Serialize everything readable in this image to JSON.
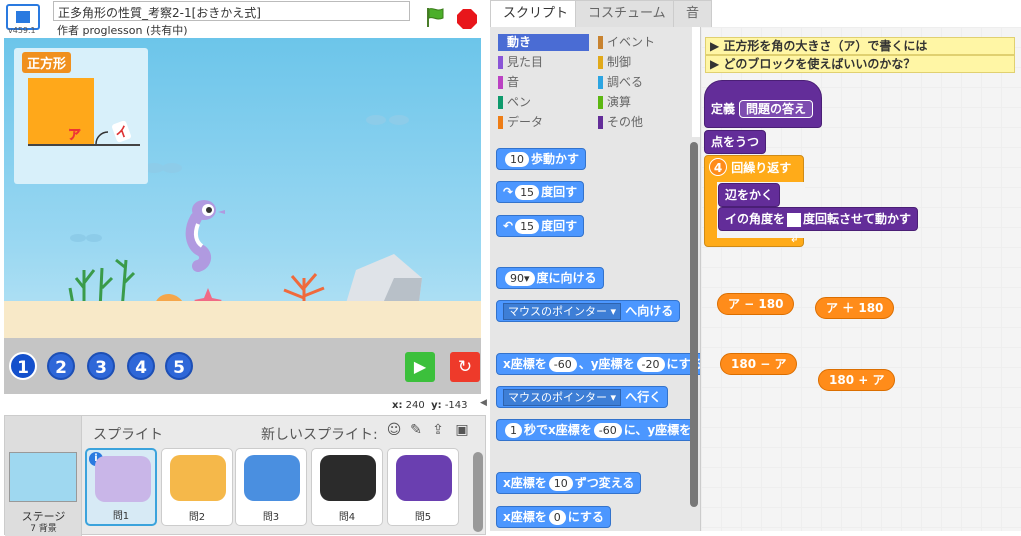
{
  "app": {
    "version": "v459.1",
    "project_title": "正多角形の性質_考察2-1[おきかえ式]",
    "author_line": "作者 proglesson (共有中)"
  },
  "stage": {
    "topic_label": "正方形",
    "angle_a": "ア",
    "angle_i": "イ",
    "number_buttons": [
      "1",
      "2",
      "3",
      "4",
      "5"
    ],
    "active_number": "1",
    "go_symbol": "▶",
    "reset_symbol": "↻",
    "coords": {
      "x_label": "x:",
      "x_value": "240",
      "y_label": "y:",
      "y_value": "-143"
    }
  },
  "sprites_panel": {
    "title": "スプライト",
    "new_sprite_label": "新しいスプライト:",
    "stage_label": "ステージ",
    "backdrop_count": "7 背景",
    "sprites": [
      {
        "name": "問1",
        "color": "#c9b6e8"
      },
      {
        "name": "問2",
        "color": "#f5b84a"
      },
      {
        "name": "問3",
        "color": "#4a8fe0"
      },
      {
        "name": "問4",
        "color": "#2b2b2b"
      },
      {
        "name": "問5",
        "color": "#6a3fb0"
      }
    ],
    "info_symbol": "i"
  },
  "tabs": [
    "スクリプト",
    "コスチューム",
    "音"
  ],
  "categories": [
    {
      "label": "動き",
      "color": "#4a6cd4",
      "active": true
    },
    {
      "label": "イベント",
      "color": "#c88330"
    },
    {
      "label": "見た目",
      "color": "#8a55d7"
    },
    {
      "label": "制御",
      "color": "#e1a91a"
    },
    {
      "label": "音",
      "color": "#bb42c3"
    },
    {
      "label": "調べる",
      "color": "#2ca5e2"
    },
    {
      "label": "ペン",
      "color": "#0e9a6c"
    },
    {
      "label": "演算",
      "color": "#5cb712"
    },
    {
      "label": "データ",
      "color": "#ee7d16"
    },
    {
      "label": "その他",
      "color": "#632d99"
    }
  ],
  "palette_blocks": {
    "move": {
      "val": "10",
      "text": "歩動かす"
    },
    "turn_right": {
      "val": "15",
      "text": "度回す"
    },
    "turn_left": {
      "val": "15",
      "text": "度回す"
    },
    "point_dir": {
      "val": "90▾",
      "text": "度に向ける"
    },
    "point_towards": {
      "drop": "マウスのポインター ▾",
      "text": "へ向ける"
    },
    "goto_xy": {
      "a": "x座標を",
      "x": "-60",
      "b": "、y座標を",
      "y": "-20",
      "c": "にする"
    },
    "goto": {
      "drop": "マウスのポインター ▾",
      "text": "へ行く"
    },
    "glide": {
      "secs": "1",
      "a": "秒でx座標を",
      "x": "-60",
      "b": "に、y座標を"
    },
    "change_x": {
      "a": "x座標を",
      "val": "10",
      "b": "ずつ変える"
    },
    "set_x": {
      "a": "x座標を",
      "val": "0",
      "b": "にする"
    }
  },
  "script_area": {
    "note_line1": "▶ 正方形を角の大きさ（ア）で書くには",
    "note_line2": "▶ どのブロックを使えばいいのかな？",
    "define_label": "定義",
    "define_name": "問題の答え",
    "dot_block": "点をうつ",
    "repeat_count": "4",
    "repeat_label": "回繰り返す",
    "draw_side": "辺をかく",
    "move_angle": "イの角度を",
    "move_angle_after": "度回転させて動かす",
    "operators": [
      "ア − 180",
      "ア ＋ 180",
      "180 − ア",
      "180 + ア"
    ]
  },
  "colors": {
    "accent_blue": "#4c97ff",
    "custom_purple": "#632d99",
    "operator_orange": "#ff8c1a",
    "control_yellow": "#ffab19"
  }
}
